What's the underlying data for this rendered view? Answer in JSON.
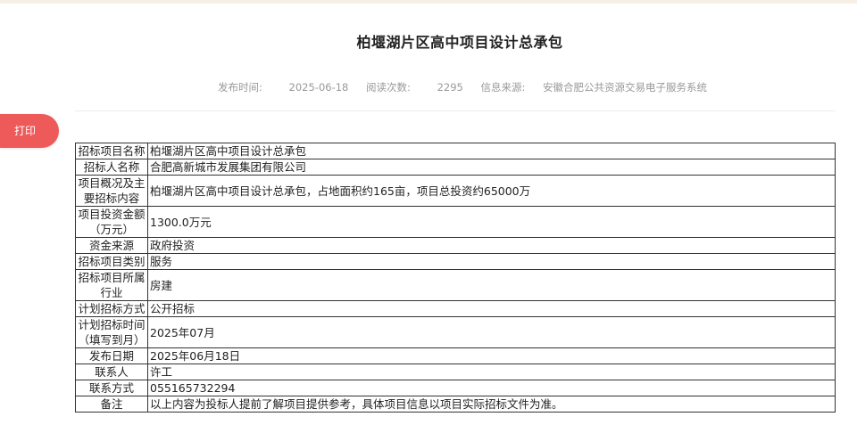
{
  "title": "柏堰湖片区高中项目设计总承包",
  "meta": {
    "publish_label": "发布时间:",
    "publish_date": "2025-06-18",
    "views_label": "阅读次数:",
    "views": "2295",
    "source_label": "信息来源:",
    "source": "安徽合肥公共资源交易电子服务系统"
  },
  "print_label": "打印",
  "rows": [
    {
      "k": "招标项目名称",
      "v": "柏堰湖片区高中项目设计总承包"
    },
    {
      "k": "招标人名称",
      "v": "合肥高新城市发展集团有限公司"
    },
    {
      "k": "项目概况及主要招标内容",
      "v": "柏堰湖片区高中项目设计总承包，占地面积约165亩，项目总投资约65000万"
    },
    {
      "k": "项目投资金额（万元）",
      "v": "1300.0万元"
    },
    {
      "k": "资金来源",
      "v": "政府投资"
    },
    {
      "k": "招标项目类别",
      "v": "服务"
    },
    {
      "k": "招标项目所属行业",
      "v": "房建"
    },
    {
      "k": "计划招标方式",
      "v": "公开招标"
    },
    {
      "k": "计划招标时间（填写到月）",
      "v": "2025年07月"
    },
    {
      "k": "发布日期",
      "v": "2025年06月18日"
    },
    {
      "k": "联系人",
      "v": "许工"
    },
    {
      "k": "联系方式",
      "v": "055165732294"
    },
    {
      "k": "备注",
      "v": "以上内容为投标人提前了解项目提供参考，具体项目信息以项目实际招标文件为准。"
    }
  ]
}
